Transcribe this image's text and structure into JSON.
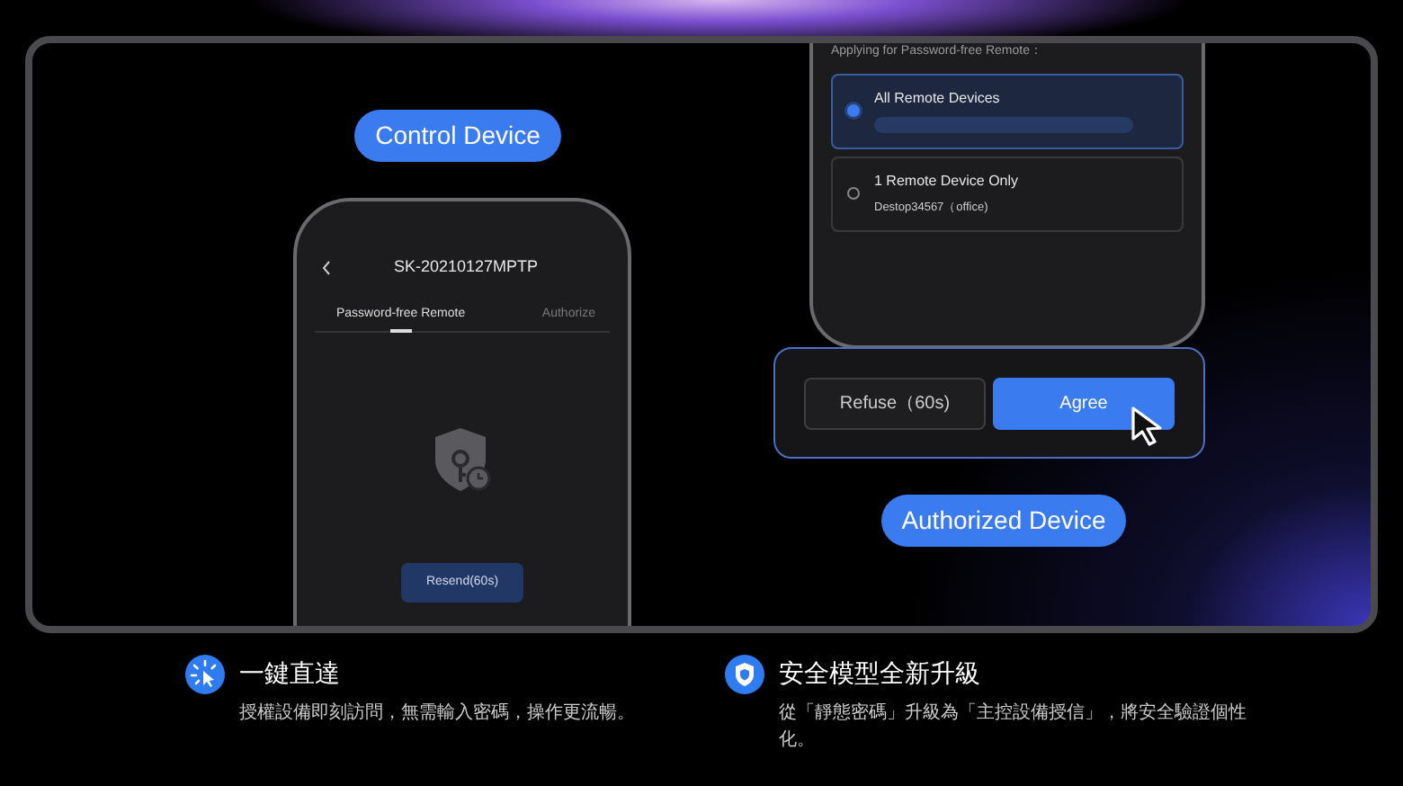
{
  "control_label": "Control Device",
  "control_phone": {
    "title": "SK-20210127MPTP",
    "tabs": [
      {
        "label": "Password-free Remote",
        "selected": true
      },
      {
        "label": "Authorize",
        "selected": false
      }
    ],
    "button": "Resend(60s)"
  },
  "authorized_phone": {
    "heading": "Applying for Password-free Remote：",
    "options": [
      {
        "title": "All Remote Devices",
        "selected": true
      },
      {
        "title": "1 Remote Device Only",
        "subtitle": "Destop34567（office)",
        "selected": false
      }
    ]
  },
  "dialog": {
    "buttons": [
      {
        "label": "Refuse（60s)",
        "kind": "secondary"
      },
      {
        "label": "Agree",
        "kind": "primary"
      }
    ]
  },
  "authorized_label": "Authorized Device",
  "features": [
    {
      "kind": "cursor",
      "title": "一鍵直達",
      "description": "授權設備即刻訪問，無需輸入密碼，操作更流暢。"
    },
    {
      "kind": "shield",
      "title": "安全模型全新升級",
      "description": "從「靜態密碼」升級為「主控設備授信」，將安全驗證個性化。"
    }
  ]
}
